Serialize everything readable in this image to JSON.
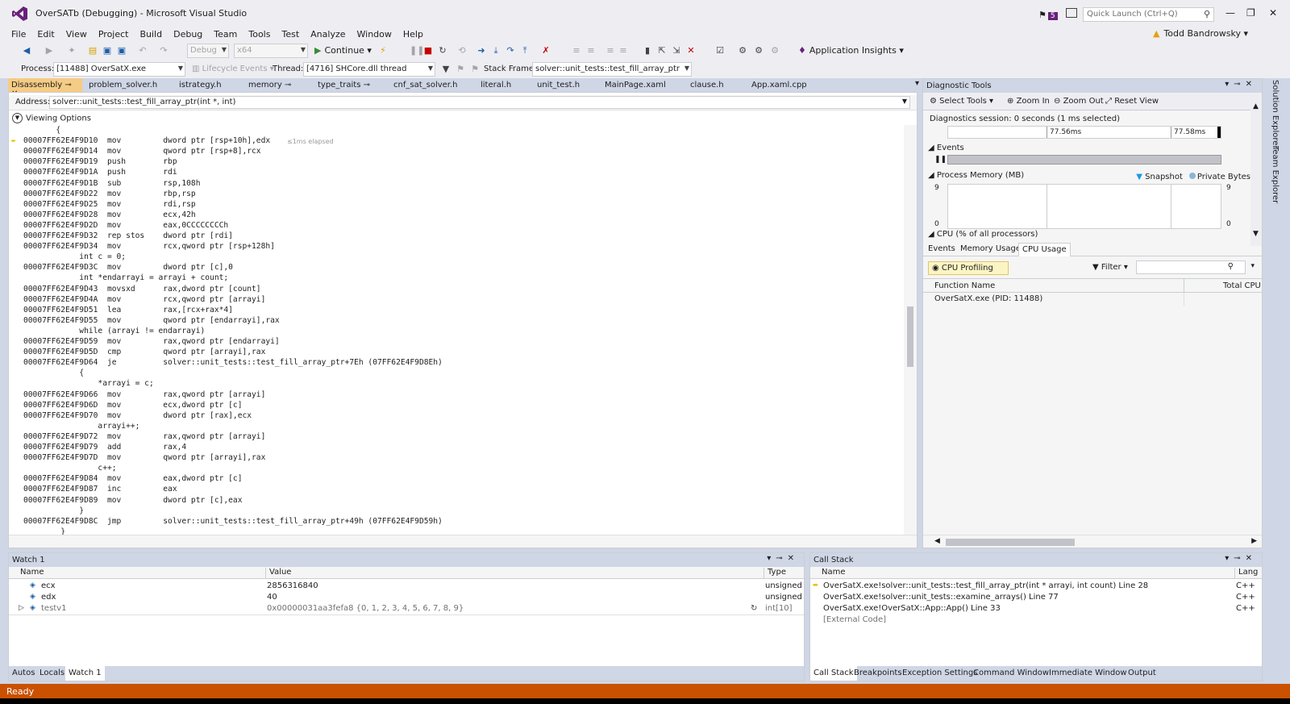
{
  "window": {
    "title": "OverSATb (Debugging) - Microsoft Visual Studio",
    "notif_count": "5",
    "quick_launch_placeholder": "Quick Launch (Ctrl+Q)",
    "user": "Todd Bandrowsky"
  },
  "menu": [
    "File",
    "Edit",
    "View",
    "Project",
    "Build",
    "Debug",
    "Team",
    "Tools",
    "Test",
    "Analyze",
    "Window",
    "Help"
  ],
  "toolbar": {
    "config": "Debug",
    "platform": "x64",
    "continue_label": "Continue",
    "app_insights": "Application Insights"
  },
  "debug_location": {
    "process_label": "Process:",
    "process": "[11488] OverSatX.exe",
    "lifecycle": "Lifecycle Events",
    "thread_label": "Thread:",
    "thread": "[4716] SHCore.dll thread",
    "frame_label": "Stack Frame:",
    "frame": "solver::unit_tests::test_fill_array_ptr"
  },
  "doc_tabs": [
    "Disassembly",
    "problem_solver.h",
    "istrategy.h",
    "memory",
    "type_traits",
    "cnf_sat_solver.h",
    "literal.h",
    "unit_test.h",
    "MainPage.xaml",
    "clause.h",
    "App.xaml.cpp"
  ],
  "editor": {
    "address_label": "Address:",
    "address": "solver::unit_tests::test_fill_array_ptr(int *, int)",
    "viewing_options": "Viewing Options",
    "elapsed": "≤1ms elapsed",
    "lines": [
      "       {",
      "00007FF62E4F9D10  mov         dword ptr [rsp+10h],edx",
      "00007FF62E4F9D14  mov         qword ptr [rsp+8],rcx",
      "00007FF62E4F9D19  push        rbp",
      "00007FF62E4F9D1A  push        rdi",
      "00007FF62E4F9D1B  sub         rsp,108h",
      "00007FF62E4F9D22  mov         rbp,rsp",
      "00007FF62E4F9D25  mov         rdi,rsp",
      "00007FF62E4F9D28  mov         ecx,42h",
      "00007FF62E4F9D2D  mov         eax,0CCCCCCCCh",
      "00007FF62E4F9D32  rep stos    dword ptr [rdi]",
      "00007FF62E4F9D34  mov         rcx,qword ptr [rsp+128h]",
      "            int c = 0;",
      "00007FF62E4F9D3C  mov         dword ptr [c],0",
      "            int *endarrayi = arrayi + count;",
      "00007FF62E4F9D43  movsxd      rax,dword ptr [count]",
      "00007FF62E4F9D4A  mov         rcx,qword ptr [arrayi]",
      "00007FF62E4F9D51  lea         rax,[rcx+rax*4]",
      "00007FF62E4F9D55  mov         qword ptr [endarrayi],rax",
      "            while (arrayi != endarrayi)",
      "00007FF62E4F9D59  mov         rax,qword ptr [endarrayi]",
      "00007FF62E4F9D5D  cmp         qword ptr [arrayi],rax",
      "00007FF62E4F9D64  je          solver::unit_tests::test_fill_array_ptr+7Eh (07FF62E4F9D8Eh)",
      "            {",
      "                *arrayi = c;",
      "00007FF62E4F9D66  mov         rax,qword ptr [arrayi]",
      "00007FF62E4F9D6D  mov         ecx,dword ptr [c]",
      "00007FF62E4F9D70  mov         dword ptr [rax],ecx",
      "                arrayi++;",
      "00007FF62E4F9D72  mov         rax,qword ptr [arrayi]",
      "00007FF62E4F9D79  add         rax,4",
      "00007FF62E4F9D7D  mov         qword ptr [arrayi],rax",
      "                c++;",
      "00007FF62E4F9D84  mov         eax,dword ptr [c]",
      "00007FF62E4F9D87  inc         eax",
      "00007FF62E4F9D89  mov         dword ptr [c],eax",
      "            }",
      "00007FF62E4F9D8C  jmp         solver::unit_tests::test_fill_array_ptr+49h (07FF62E4F9D59h)",
      "        }"
    ]
  },
  "diagnostics": {
    "title": "Diagnostic Tools",
    "select_tools": "Select Tools",
    "zoom_in": "Zoom In",
    "zoom_out": "Zoom Out",
    "reset_view": "Reset View",
    "session": "Diagnostics session: 0 seconds (1 ms selected)",
    "ruler_a": "77.56ms",
    "ruler_b": "77.58ms",
    "events": "Events",
    "process_memory": "Process Memory (MB)",
    "snapshot": "Snapshot",
    "private_bytes": "Private Bytes",
    "y_max": "9",
    "y_min": "0",
    "cpu": "CPU (% of all processors)",
    "tabs": [
      "Events",
      "Memory Usage",
      "CPU Usage"
    ],
    "cpu_profiling": "CPU Profiling",
    "filter": "Filter",
    "col_function": "Function Name",
    "col_total": "Total CPU",
    "row": "OverSatX.exe (PID: 11488)"
  },
  "side_tabs": [
    "Solution Explorer",
    "Team Explorer"
  ],
  "watch": {
    "title": "Watch 1",
    "cols": [
      "Name",
      "Value",
      "Type"
    ],
    "rows": [
      {
        "name": "ecx",
        "value": "2856316840",
        "type": "unsigned"
      },
      {
        "name": "edx",
        "value": "40",
        "type": "unsigned"
      },
      {
        "name": "testv1",
        "value": "0x00000031aa3fefa8 {0, 1, 2, 3, 4, 5, 6, 7, 8, 9}",
        "type": "int[10]"
      }
    ],
    "tabs": [
      "Autos",
      "Locals",
      "Watch 1"
    ]
  },
  "callstack": {
    "title": "Call Stack",
    "cols": [
      "Name",
      "Lang"
    ],
    "rows": [
      {
        "name": "OverSatX.exe!solver::unit_tests::test_fill_array_ptr(int * arrayi, int count) Line 28",
        "lang": "C++"
      },
      {
        "name": "OverSatX.exe!solver::unit_tests::examine_arrays() Line 77",
        "lang": "C++"
      },
      {
        "name": "OverSatX.exe!OverSatX::App::App() Line 33",
        "lang": "C++"
      },
      {
        "name": "[External Code]",
        "lang": ""
      }
    ],
    "tabs": [
      "Call Stack",
      "Breakpoints",
      "Exception Settings",
      "Command Window",
      "Immediate Window",
      "Output"
    ]
  },
  "status": "Ready"
}
